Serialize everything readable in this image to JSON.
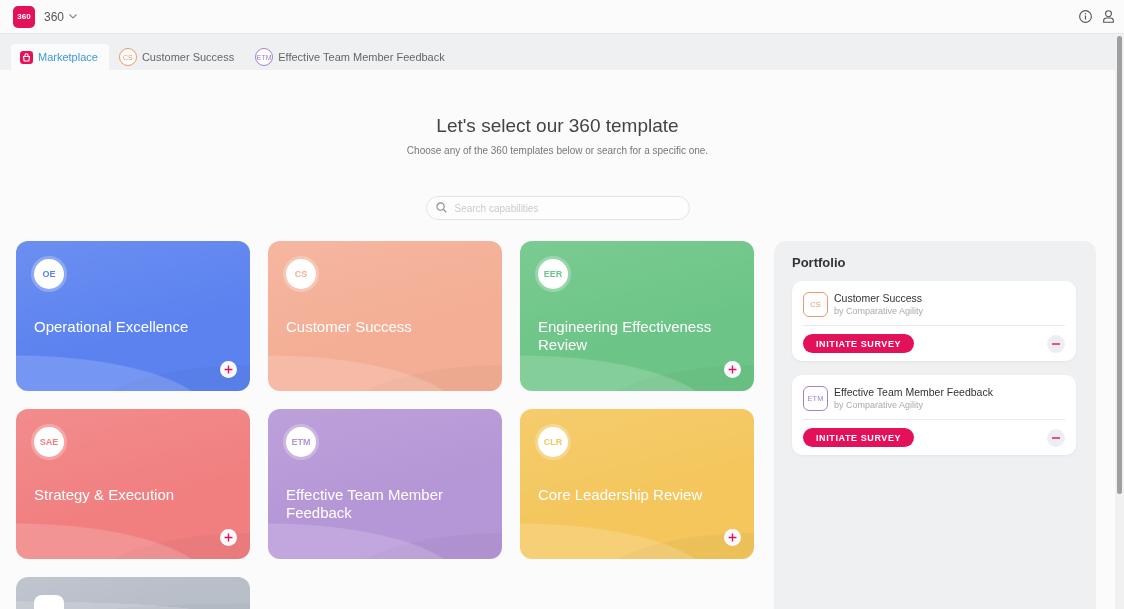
{
  "app_bar": {
    "logo_text": "360",
    "product": "360"
  },
  "tabs": [
    {
      "kind": "home",
      "label": "Marketplace",
      "selected": true
    },
    {
      "kind": "template",
      "badge": "CS",
      "color": "#f0956e",
      "label": "Customer Success",
      "selected": false
    },
    {
      "kind": "template",
      "badge": "ETM",
      "color": "#a77fd0",
      "label": "Effective Team Member Feedback",
      "selected": false
    }
  ],
  "header": {
    "title": "Let's select our 360 template",
    "subtitle": "Choose any of the 360 templates below or search for a specific one."
  },
  "search": {
    "placeholder": "Search capabilities"
  },
  "templates": [
    {
      "badge": "OE",
      "title": "Operational Excellence",
      "color": "#5b82ef",
      "in_portfolio": false
    },
    {
      "badge": "CS",
      "title": "Customer Success",
      "color": "#f4ae95",
      "in_portfolio": true
    },
    {
      "badge": "EER",
      "title": "Engineering Effectiveness Review",
      "color": "#6cc586",
      "in_portfolio": false
    },
    {
      "badge": "SAE",
      "title": "Strategy & Execution",
      "color": "#f17f80",
      "in_portfolio": false
    },
    {
      "badge": "ETM",
      "title": "Effective Team Member Feedback",
      "color": "#b596d6",
      "in_portfolio": true
    },
    {
      "badge": "CLR",
      "title": "Core Leadership Review",
      "color": "#f4c65c",
      "in_portfolio": false
    },
    {
      "color": "#b9bfc9"
    }
  ],
  "portfolio": {
    "title": "Portfolio",
    "items": [
      {
        "badge": "CS",
        "color": "#f0956e",
        "name": "Customer Success",
        "author": "by Comparative Agility",
        "action": "INITIATE SURVEY"
      },
      {
        "badge": "ETM",
        "color": "#a77fd0",
        "name": "Effective Team Member Feedback",
        "author": "by Comparative Agility",
        "action": "INITIATE SURVEY"
      }
    ]
  }
}
